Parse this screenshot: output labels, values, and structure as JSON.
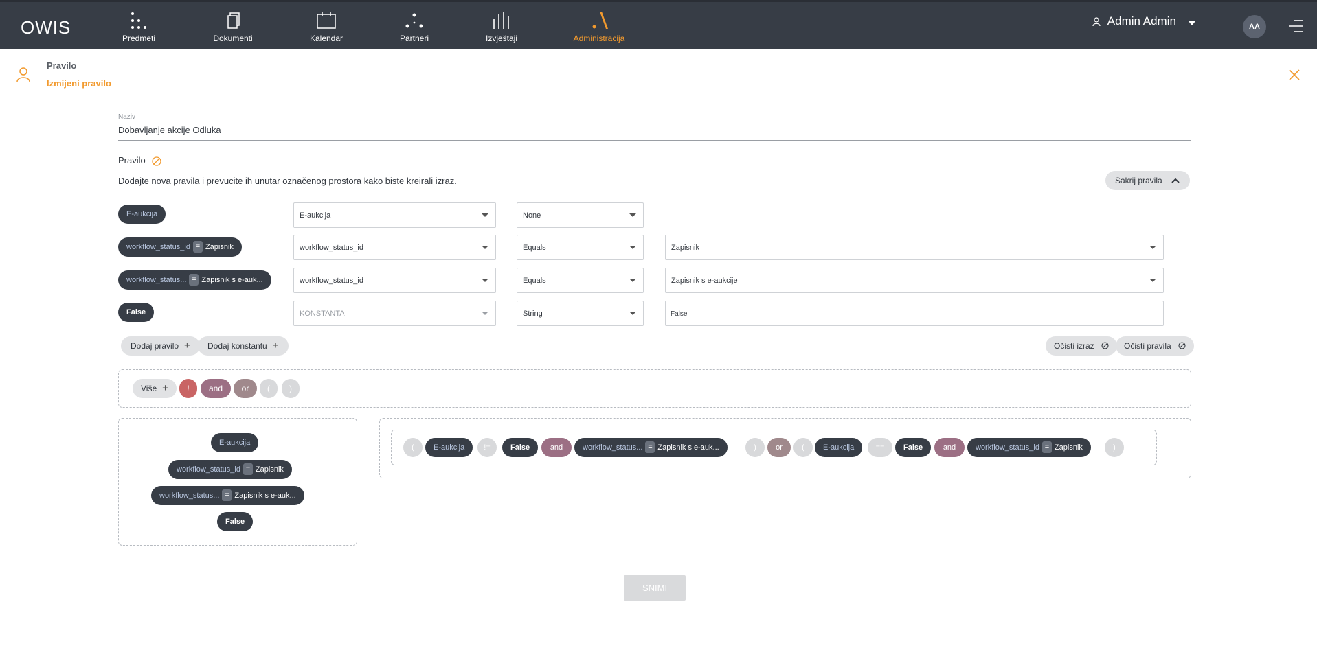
{
  "app": {
    "logo": "OWIS"
  },
  "nav": [
    {
      "label": "Predmeti",
      "icon": "dots-grid-icon",
      "active": false
    },
    {
      "label": "Dokumenti",
      "icon": "documents-icon",
      "active": false
    },
    {
      "label": "Kalendar",
      "icon": "calendar-icon",
      "active": false
    },
    {
      "label": "Partneri",
      "icon": "partners-icon",
      "active": false
    },
    {
      "label": "Izvještaji",
      "icon": "reports-icon",
      "active": false
    },
    {
      "label": "Administracija",
      "icon": "admin-icon",
      "active": true
    }
  ],
  "user": {
    "name": "Admin Admin",
    "initials": "AA"
  },
  "colors": {
    "accent": "#f29a2e",
    "topbar": "#373d46",
    "pill_dark": "#373d46",
    "op_not": "#c96464",
    "op_and": "#9c6f84",
    "op_or": "#a0898c"
  },
  "header": {
    "title": "Pravilo",
    "subtitle": "Izmijeni pravilo"
  },
  "form": {
    "name_label": "Naziv",
    "name_value": "Dobavljanje akcije Odluka",
    "rule_title": "Pravilo",
    "hint": "Dodajte nova pravila i prevucite ih unutar označenog prostora kako biste kreirali izraz.",
    "hide_rules_label": "Sakrij pravila"
  },
  "rules": [
    {
      "pill_key": "E-aukcija",
      "pill_eq": "",
      "pill_val": "",
      "field": "E-aukcija",
      "operator": "None",
      "value": "",
      "value_type": "none"
    },
    {
      "pill_key": "workflow_status_id",
      "pill_eq": "=",
      "pill_val": "Zapisnik",
      "field": "workflow_status_id",
      "operator": "Equals",
      "value": "Zapisnik",
      "value_type": "select"
    },
    {
      "pill_key": "workflow_status...",
      "pill_eq": "=",
      "pill_val": "Zapisnik s e-auk...",
      "field": "workflow_status_id",
      "operator": "Equals",
      "value": "Zapisnik s e-aukcije",
      "value_type": "select"
    },
    {
      "pill_key": "False",
      "pill_eq": "",
      "pill_val": "",
      "field": "KONSTANTA",
      "operator": "String",
      "value": "False",
      "value_type": "input"
    }
  ],
  "actions": {
    "add_rule": "Dodaj pravilo",
    "add_constant": "Dodaj konstantu",
    "clear_expression": "Očisti izraz",
    "clear_rules": "Očisti pravila"
  },
  "operators": {
    "more": "Više",
    "not": "!",
    "and": "and",
    "or": "or",
    "open": "(",
    "close": ")"
  },
  "palette": [
    {
      "key": "E-aukcija",
      "eq": "",
      "val": ""
    },
    {
      "key": "workflow_status_id",
      "eq": "=",
      "val": "Zapisnik"
    },
    {
      "key": "workflow_status...",
      "eq": "=",
      "val": "Zapisnik s e-auk..."
    },
    {
      "key": "False",
      "eq": "",
      "val": ""
    }
  ],
  "expression": [
    {
      "type": "paren",
      "text": "("
    },
    {
      "type": "rule",
      "key": "E-aukcija",
      "eq": "",
      "val": ""
    },
    {
      "type": "paren",
      "text": "!="
    },
    {
      "type": "rule",
      "key": "False",
      "eq": "",
      "val": ""
    },
    {
      "type": "and",
      "text": "and"
    },
    {
      "type": "rule",
      "key": "workflow_status...",
      "eq": "=",
      "val": "Zapisnik s e-auk..."
    },
    {
      "type": "paren",
      "text": ")"
    },
    {
      "type": "or",
      "text": "or"
    },
    {
      "type": "paren",
      "text": "("
    },
    {
      "type": "rule",
      "key": "E-aukcija",
      "eq": "",
      "val": ""
    },
    {
      "type": "paren",
      "text": "=="
    },
    {
      "type": "rule",
      "key": "False",
      "eq": "",
      "val": ""
    },
    {
      "type": "and",
      "text": "and"
    },
    {
      "type": "rule",
      "key": "workflow_status_id",
      "eq": "=",
      "val": "Zapisnik"
    },
    {
      "type": "paren",
      "text": ")"
    }
  ],
  "save_label": "SNIMI"
}
